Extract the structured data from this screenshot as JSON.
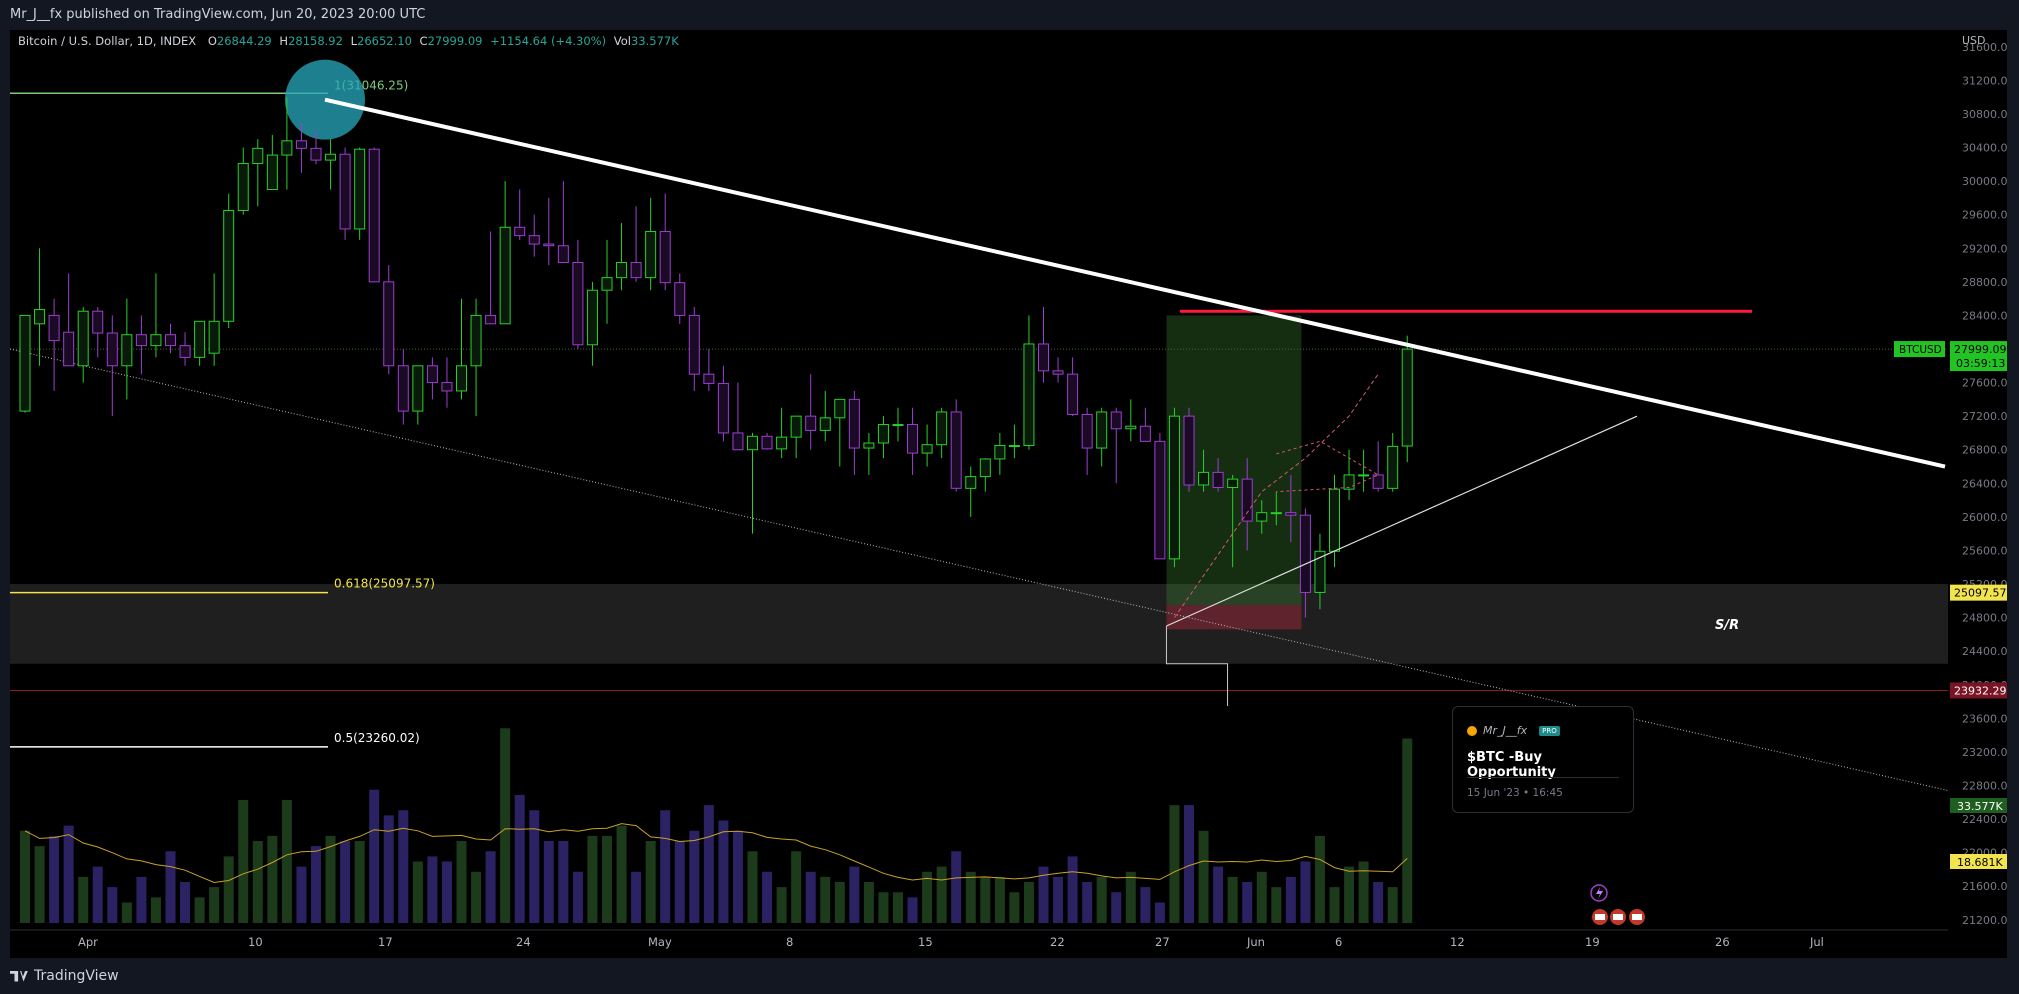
{
  "header": {
    "published": "Mr_J__fx published on TradingView.com, Jun 20, 2023 20:00 UTC"
  },
  "legend": {
    "symbol": "Bitcoin / U.S. Dollar, 1D, INDEX",
    "o_label": "O",
    "o_value": "26844.29",
    "h_label": "H",
    "h_value": "28158.92",
    "l_label": "L",
    "l_value": "26652.10",
    "c_label": "C",
    "c_value": "27999.09",
    "change": "+1154.64 (+4.30%)",
    "vol_label": "Vol",
    "vol_value": "33.577K"
  },
  "footer": {
    "brand": "TradingView"
  },
  "popup": {
    "author": "Mr_J__fx",
    "badge": "PRO",
    "title": "$BTC -Buy Opportunity",
    "date": "15 Jun '23 • 16:45"
  },
  "colors": {
    "up": "#28d028",
    "down": "#9b3fd0",
    "vol_up": "#1c3b1a",
    "vol_down": "#2b2264",
    "trendline": "#ffffff",
    "resistance": "#ff1a3c",
    "fib_top": "#7ec87e",
    "fib_618": "#f2e44c",
    "fib_05": "#ffffff"
  },
  "chart_data": {
    "type": "candlestick",
    "currency": "USD",
    "ylim": [
      20900,
      31800
    ],
    "x_labels": [
      "Apr",
      "10",
      "17",
      "24",
      "May",
      "8",
      "15",
      "22",
      "27",
      "Jun",
      "6",
      "12",
      "19",
      "26",
      "Jul"
    ],
    "y_ticks": [
      21200,
      21600,
      22000,
      22400,
      22800,
      23200,
      23600,
      24000,
      24400,
      24800,
      25200,
      25600,
      26000,
      26400,
      26800,
      27200,
      27600,
      28000,
      28400,
      28800,
      29200,
      29600,
      30000,
      30400,
      30800,
      31200,
      31600
    ],
    "candles": [
      {
        "o": 27260,
        "h": 28300,
        "l": 27240,
        "c": 28400
      },
      {
        "o": 28300,
        "h": 29200,
        "l": 27800,
        "c": 28470
      },
      {
        "o": 28400,
        "h": 28600,
        "l": 27500,
        "c": 28100
      },
      {
        "o": 28200,
        "h": 28900,
        "l": 27850,
        "c": 27800
      },
      {
        "o": 27800,
        "h": 28500,
        "l": 27600,
        "c": 28450
      },
      {
        "o": 28450,
        "h": 28500,
        "l": 27900,
        "c": 28190
      },
      {
        "o": 28190,
        "h": 28400,
        "l": 27200,
        "c": 27800
      },
      {
        "o": 27800,
        "h": 28600,
        "l": 27400,
        "c": 28170
      },
      {
        "o": 28170,
        "h": 28400,
        "l": 27700,
        "c": 28040
      },
      {
        "o": 28040,
        "h": 28900,
        "l": 27900,
        "c": 28170
      },
      {
        "o": 28170,
        "h": 28300,
        "l": 27950,
        "c": 28040
      },
      {
        "o": 28040,
        "h": 28200,
        "l": 27800,
        "c": 27900
      },
      {
        "o": 27900,
        "h": 28200,
        "l": 27800,
        "c": 28330
      },
      {
        "o": 27950,
        "h": 28900,
        "l": 27800,
        "c": 28330
      },
      {
        "o": 28330,
        "h": 29850,
        "l": 28250,
        "c": 29650
      },
      {
        "o": 29650,
        "h": 30400,
        "l": 29600,
        "c": 30210
      },
      {
        "o": 30210,
        "h": 30500,
        "l": 29700,
        "c": 30390
      },
      {
        "o": 29900,
        "h": 30550,
        "l": 29900,
        "c": 30310
      },
      {
        "o": 30310,
        "h": 31000,
        "l": 29900,
        "c": 30480
      },
      {
        "o": 30480,
        "h": 30700,
        "l": 30100,
        "c": 30390
      },
      {
        "o": 30390,
        "h": 30600,
        "l": 30200,
        "c": 30250
      },
      {
        "o": 30250,
        "h": 30500,
        "l": 29900,
        "c": 30320
      },
      {
        "o": 30320,
        "h": 30400,
        "l": 29300,
        "c": 29430
      },
      {
        "o": 29430,
        "h": 30400,
        "l": 29300,
        "c": 30380
      },
      {
        "o": 30380,
        "h": 30400,
        "l": 28900,
        "c": 28800
      },
      {
        "o": 28800,
        "h": 29000,
        "l": 27700,
        "c": 27800
      },
      {
        "o": 27800,
        "h": 28000,
        "l": 27100,
        "c": 27260
      },
      {
        "o": 27260,
        "h": 27800,
        "l": 27100,
        "c": 27800
      },
      {
        "o": 27800,
        "h": 27900,
        "l": 27400,
        "c": 27600
      },
      {
        "o": 27600,
        "h": 27900,
        "l": 27300,
        "c": 27500
      },
      {
        "o": 27500,
        "h": 28600,
        "l": 27400,
        "c": 27800
      },
      {
        "o": 27800,
        "h": 28600,
        "l": 27200,
        "c": 28400
      },
      {
        "o": 28400,
        "h": 29400,
        "l": 28300,
        "c": 28300
      },
      {
        "o": 28300,
        "h": 30000,
        "l": 28300,
        "c": 29450
      },
      {
        "o": 29450,
        "h": 29900,
        "l": 29300,
        "c": 29350
      },
      {
        "o": 29350,
        "h": 29600,
        "l": 29100,
        "c": 29250
      },
      {
        "o": 29250,
        "h": 29800,
        "l": 29000,
        "c": 29230
      },
      {
        "o": 29230,
        "h": 30000,
        "l": 29100,
        "c": 29030
      },
      {
        "o": 29030,
        "h": 29300,
        "l": 28000,
        "c": 28050
      },
      {
        "o": 28050,
        "h": 28800,
        "l": 27800,
        "c": 28700
      },
      {
        "o": 28700,
        "h": 29300,
        "l": 28300,
        "c": 28850
      },
      {
        "o": 28850,
        "h": 29500,
        "l": 28700,
        "c": 29030
      },
      {
        "o": 29030,
        "h": 29700,
        "l": 28800,
        "c": 28850
      },
      {
        "o": 28850,
        "h": 29800,
        "l": 28700,
        "c": 29400
      },
      {
        "o": 29400,
        "h": 29850,
        "l": 28700,
        "c": 28790
      },
      {
        "o": 28790,
        "h": 28900,
        "l": 28300,
        "c": 28400
      },
      {
        "o": 28400,
        "h": 28500,
        "l": 27500,
        "c": 27700
      },
      {
        "o": 27700,
        "h": 28000,
        "l": 27500,
        "c": 27590
      },
      {
        "o": 27590,
        "h": 27800,
        "l": 26900,
        "c": 27000
      },
      {
        "o": 27000,
        "h": 27600,
        "l": 26800,
        "c": 26800
      },
      {
        "o": 26800,
        "h": 27000,
        "l": 25800,
        "c": 26960
      },
      {
        "o": 26960,
        "h": 27000,
        "l": 26800,
        "c": 26810
      },
      {
        "o": 26810,
        "h": 27300,
        "l": 26700,
        "c": 26950
      },
      {
        "o": 26950,
        "h": 27200,
        "l": 26700,
        "c": 27200
      },
      {
        "o": 27200,
        "h": 27700,
        "l": 26800,
        "c": 27030
      },
      {
        "o": 27030,
        "h": 27500,
        "l": 26900,
        "c": 27180
      },
      {
        "o": 27180,
        "h": 27400,
        "l": 26600,
        "c": 27400
      },
      {
        "o": 27400,
        "h": 27500,
        "l": 26500,
        "c": 26820
      },
      {
        "o": 26820,
        "h": 27000,
        "l": 26500,
        "c": 26880
      },
      {
        "o": 26880,
        "h": 27200,
        "l": 26700,
        "c": 27100
      },
      {
        "o": 27100,
        "h": 27300,
        "l": 26900,
        "c": 27100
      },
      {
        "o": 27100,
        "h": 27300,
        "l": 26500,
        "c": 26760
      },
      {
        "o": 26760,
        "h": 27100,
        "l": 26600,
        "c": 26860
      },
      {
        "o": 26860,
        "h": 27300,
        "l": 26700,
        "c": 27250
      },
      {
        "o": 27250,
        "h": 27400,
        "l": 26300,
        "c": 26340
      },
      {
        "o": 26340,
        "h": 26600,
        "l": 26000,
        "c": 26480
      },
      {
        "o": 26480,
        "h": 26700,
        "l": 26300,
        "c": 26690
      },
      {
        "o": 26690,
        "h": 27000,
        "l": 26500,
        "c": 26850
      },
      {
        "o": 26850,
        "h": 27100,
        "l": 26700,
        "c": 26850
      },
      {
        "o": 26850,
        "h": 28400,
        "l": 26800,
        "c": 28060
      },
      {
        "o": 28060,
        "h": 28500,
        "l": 27600,
        "c": 27740
      },
      {
        "o": 27740,
        "h": 27900,
        "l": 27600,
        "c": 27700
      },
      {
        "o": 27700,
        "h": 27900,
        "l": 27200,
        "c": 27220
      },
      {
        "o": 27220,
        "h": 27300,
        "l": 26500,
        "c": 26820
      },
      {
        "o": 26820,
        "h": 27300,
        "l": 26600,
        "c": 27250
      },
      {
        "o": 27250,
        "h": 27300,
        "l": 26400,
        "c": 27050
      },
      {
        "o": 27050,
        "h": 27400,
        "l": 26900,
        "c": 27080
      },
      {
        "o": 27080,
        "h": 27300,
        "l": 26900,
        "c": 26900
      },
      {
        "o": 26900,
        "h": 27000,
        "l": 25700,
        "c": 25500
      },
      {
        "o": 25500,
        "h": 27300,
        "l": 25400,
        "c": 27200
      },
      {
        "o": 27200,
        "h": 27300,
        "l": 26300,
        "c": 26380
      },
      {
        "o": 26380,
        "h": 26800,
        "l": 26300,
        "c": 26530
      },
      {
        "o": 26530,
        "h": 26700,
        "l": 26300,
        "c": 26350
      },
      {
        "o": 26350,
        "h": 26500,
        "l": 25400,
        "c": 26450
      },
      {
        "o": 26450,
        "h": 26700,
        "l": 25600,
        "c": 25950
      },
      {
        "o": 25950,
        "h": 26200,
        "l": 25800,
        "c": 26050
      },
      {
        "o": 26050,
        "h": 26300,
        "l": 25900,
        "c": 26050
      },
      {
        "o": 26050,
        "h": 26500,
        "l": 25700,
        "c": 26020
      },
      {
        "o": 26020,
        "h": 26100,
        "l": 24800,
        "c": 25100
      },
      {
        "o": 25100,
        "h": 25800,
        "l": 24900,
        "c": 25590
      },
      {
        "o": 25590,
        "h": 26500,
        "l": 25400,
        "c": 26330
      },
      {
        "o": 26330,
        "h": 26800,
        "l": 26200,
        "c": 26500
      },
      {
        "o": 26500,
        "h": 26800,
        "l": 26300,
        "c": 26500
      },
      {
        "o": 26500,
        "h": 26900,
        "l": 26300,
        "c": 26340
      },
      {
        "o": 26340,
        "h": 27000,
        "l": 26300,
        "c": 26840
      },
      {
        "o": 26844.29,
        "h": 28158.92,
        "l": 26652.1,
        "c": 27999.09
      }
    ],
    "volume_pane": {
      "ylim": [
        0,
        2000000
      ],
      "ma_color": "#c9a227"
    },
    "annotations": {
      "fib_top": {
        "label": "1(31046.25)",
        "value": 31046.25
      },
      "fib_618": {
        "label": "0.618(25097.57)",
        "value": 25097.57
      },
      "fib_05": {
        "label": "0.5(23260.02)",
        "value": 23260.02
      },
      "sr_zone": {
        "label": "S/R",
        "top": 25200,
        "bottom": 24250
      },
      "resistance": {
        "value": 28450
      },
      "support_line": {
        "value": 23932.29
      },
      "long_position": {
        "entry": 24950,
        "target": 28400,
        "stop": 24660
      },
      "price_label": {
        "symbol": "BTCUSD",
        "price": "27999.09",
        "countdown": "03:59:13"
      },
      "levels_labels": {
        "p618": "25097.57",
        "p23932": "23932.29"
      },
      "volume_labels": {
        "vol": "33.577K",
        "vol_ma": "18.681K"
      }
    }
  }
}
